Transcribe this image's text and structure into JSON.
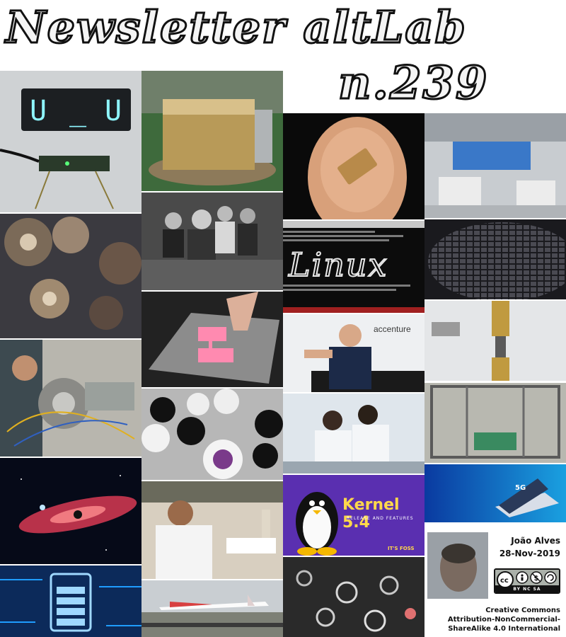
{
  "header": {
    "title": "Newsletter altLab",
    "issue": "n.239"
  },
  "footer": {
    "author": "João Alves",
    "date": "28-Nov-2019",
    "license_line1": "Creative Commons",
    "license_line2": "Attribution-NonCommercial-",
    "license_line3": "ShareAlike 4.0 International"
  },
  "license_badge": {
    "text": "BY  NC  SA"
  },
  "tiles": {
    "kernel": {
      "title": "Kernel 5.4",
      "subtitle": "RELEASE AND FEATURES",
      "brand": "IT'S FOSS"
    },
    "accenture": "accenture",
    "terminal": "Linux",
    "fiveg": "5G"
  },
  "colors": {
    "title_fill": "#f4f4f4",
    "title_stroke": "#111111",
    "kernel_bg": "#5a2fb0",
    "kernel_text": "#ffd84a",
    "terminal_bg": "#0c0c0c"
  }
}
